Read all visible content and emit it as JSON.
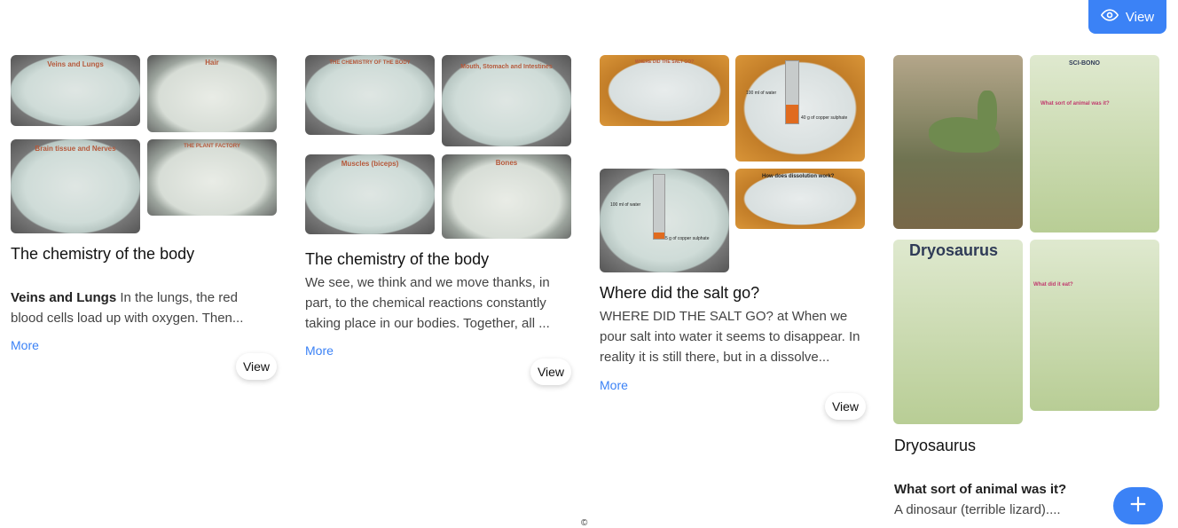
{
  "header": {
    "view_label": "View"
  },
  "cards": [
    {
      "title": "The chemistry of the body",
      "text_bold": "Veins and Lungs",
      "text": " In the lungs, the red blood cells load up with oxygen. Then...",
      "more": "More",
      "view": "View",
      "thumbs": [
        "Veins and Lungs",
        "Hair",
        "Brain tissue and Nerves",
        "THE PLANT FACTORY"
      ]
    },
    {
      "title": "The chemistry of the body",
      "text": "We see, we think and we move thanks, in part, to the chemical reactions constantly taking place in our bodies. Together, all ...",
      "more": "More",
      "view": "View",
      "thumbs": [
        "THE CHEMISTRY OF THE BODY",
        "Mouth, Stomach and Intestines",
        "Muscles (biceps)",
        "Bones"
      ]
    },
    {
      "title": "Where did the salt go?",
      "text": "WHERE DID THE SALT GO? at When we pour salt into water it seems to disappear. In reality it is still there, but in a dissolve...",
      "more": "More",
      "view": "View",
      "thumbs": [
        "WHERE DID THE SALT GO?",
        "100 ml of water",
        "40 g of copper sulphate",
        "100 ml of water",
        "5 g of copper sulphate",
        "How does dissolution work?"
      ]
    },
    {
      "title": "Dryosaurus",
      "text_bold": "What sort of animal was it?",
      "text": "A dinosaur (terrible lizard)....",
      "thumbs": [
        "SCI-BONO",
        "What sort of animal was it?",
        "Dryosaurus",
        "What did it eat?"
      ]
    }
  ],
  "fab": {
    "icon": "plus-icon"
  },
  "footer": {
    "copyright": "©"
  },
  "colors": {
    "accent": "#3b82f6"
  }
}
